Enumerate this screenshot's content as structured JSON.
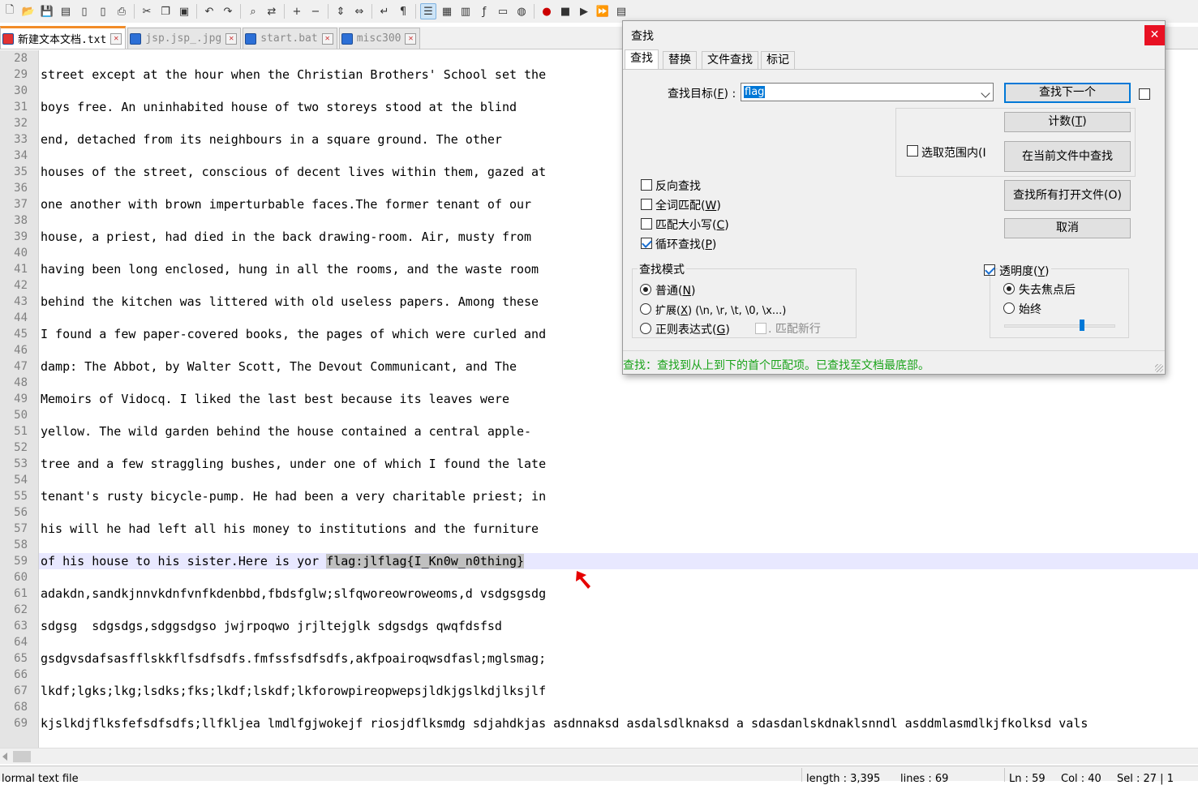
{
  "toolbar": {
    "icons": [
      "new-file-icon",
      "open-file-icon",
      "save-icon",
      "save-all-icon",
      "close-icon",
      "close-all-icon",
      "print-icon",
      "cut-icon",
      "copy-icon",
      "paste-icon",
      "undo-icon",
      "redo-icon",
      "find-icon",
      "replace-icon",
      "zoom-in-icon",
      "zoom-out-icon",
      "sync-vertical-icon",
      "sync-horizontal-icon",
      "word-wrap-icon",
      "show-all-chars-icon",
      "indent-guide-icon",
      "user-lang-icon",
      "doc-map-icon",
      "function-list-icon",
      "folder-workspace-icon",
      "monitor-icon",
      "record-macro-icon",
      "stop-macro-icon",
      "play-macro-icon",
      "run-macro-multiple-icon",
      "save-macro-icon"
    ]
  },
  "tabs": [
    {
      "label": "新建文本文档.txt",
      "active": true,
      "icon_color": "#e33333"
    },
    {
      "label": "jsp.jsp_.jpg",
      "active": false,
      "icon_color": "#2c6fd6"
    },
    {
      "label": "start.bat",
      "active": false,
      "icon_color": "#2c6fd6"
    },
    {
      "label": "misc300",
      "active": false,
      "icon_color": "#2c6fd6"
    }
  ],
  "editor": {
    "lines": [
      {
        "n": "28",
        "text": ""
      },
      {
        "n": "29",
        "text": "street except at the hour when the Christian Brothers' School set the"
      },
      {
        "n": "30",
        "text": ""
      },
      {
        "n": "31",
        "text": "boys free. An uninhabited house of two storeys stood at the blind"
      },
      {
        "n": "32",
        "text": ""
      },
      {
        "n": "33",
        "text": "end, detached from its neighbours in a square ground. The other"
      },
      {
        "n": "34",
        "text": ""
      },
      {
        "n": "35",
        "text": "houses of the street, conscious of decent lives within them, gazed at"
      },
      {
        "n": "36",
        "text": ""
      },
      {
        "n": "37",
        "text": "one another with brown imperturbable faces.The former tenant of our"
      },
      {
        "n": "38",
        "text": ""
      },
      {
        "n": "39",
        "text": "house, a priest, had died in the back drawing-room. Air, musty from"
      },
      {
        "n": "40",
        "text": ""
      },
      {
        "n": "41",
        "text": "having been long enclosed, hung in all the rooms, and the waste room"
      },
      {
        "n": "42",
        "text": ""
      },
      {
        "n": "43",
        "text": "behind the kitchen was littered with old useless papers. Among these"
      },
      {
        "n": "44",
        "text": ""
      },
      {
        "n": "45",
        "text": "I found a few paper-covered books, the pages of which were curled and"
      },
      {
        "n": "46",
        "text": ""
      },
      {
        "n": "47",
        "text": "damp: The Abbot, by Walter Scott, The Devout Communicant, and The"
      },
      {
        "n": "48",
        "text": ""
      },
      {
        "n": "49",
        "text": "Memoirs of Vidocq. I liked the last best because its leaves were"
      },
      {
        "n": "50",
        "text": ""
      },
      {
        "n": "51",
        "text": "yellow. The wild garden behind the house contained a central apple-"
      },
      {
        "n": "52",
        "text": ""
      },
      {
        "n": "53",
        "text": "tree and a few straggling bushes, under one of which I found the late"
      },
      {
        "n": "54",
        "text": ""
      },
      {
        "n": "55",
        "text": "tenant's rusty bicycle-pump. He had been a very charitable priest; in"
      },
      {
        "n": "56",
        "text": ""
      },
      {
        "n": "57",
        "text": "his will he had left all his money to institutions and the furniture"
      },
      {
        "n": "58",
        "text": ""
      },
      {
        "n": "59",
        "text": "of his house to his sister.Here is yor ",
        "highlight": "flag:jlflag{I_Kn0w_n0thing}"
      },
      {
        "n": "60",
        "text": ""
      },
      {
        "n": "61",
        "text": "adakdn,sandkjnnvkdnfvnfkdenbbd,fbdsfglw;slfqworeowroweoms,d vsdgsgsdg"
      },
      {
        "n": "62",
        "text": ""
      },
      {
        "n": "63",
        "text": "sdgsg  sdgsdgs,sdggsdgso jwjrpoqwo jrjltejglk sdgsdgs qwqfdsfsd"
      },
      {
        "n": "64",
        "text": ""
      },
      {
        "n": "65",
        "text": "gsdgvsdafsasfflskkflfsdfsdfs.fmfssfsdfsdfs,akfpoairoqwsdfasl;mglsmag;"
      },
      {
        "n": "66",
        "text": ""
      },
      {
        "n": "67",
        "text": "lkdf;lgks;lkg;lsdks;fks;lkdf;lskdf;lkforowpireopwepsjldkjgslkdjlksjlf"
      },
      {
        "n": "68",
        "text": ""
      },
      {
        "n": "69",
        "text": "kjslkdjflksfefsdfsdfs;llfkljea lmdlfgjwokejf riosjdflksmdg sdjahdkjas asdnnaksd asdalsdlknaksd a sdasdanlskdnaklsnndl asddmlasmdlkjfkolksd vals"
      }
    ]
  },
  "status": {
    "filetype": "lormal text file",
    "length": "length : 3,395",
    "lines": "lines : 69",
    "ln": "Ln : 59",
    "col": "Col : 40",
    "sel": "Sel : 27 | 1"
  },
  "dialog": {
    "title": "查找",
    "close": "✕",
    "tabs": [
      "查找",
      "替换",
      "文件查找",
      "标记"
    ],
    "find_label": "查找目标(F) :",
    "find_value": "flag",
    "buttons": {
      "find_next": "查找下一个",
      "count": "计数(T)",
      "find_in_current": "在当前文件中查找",
      "find_all_open": "查找所有打开文件(O)",
      "cancel": "取消"
    },
    "in_selection": "选取范围内(I",
    "options": [
      {
        "label": "反向查找",
        "checked": false
      },
      {
        "label": "全词匹配(W)",
        "checked": false
      },
      {
        "label": "匹配大小写(C)",
        "checked": false
      },
      {
        "label": "循环查找(P)",
        "checked": true
      }
    ],
    "search_mode": {
      "title": "查找模式",
      "normal": "普通(N)",
      "extended": "扩展(X) (\\n, \\r, \\t, \\0, \\x...)",
      "regex": "正则表达式(G)",
      "match_newline": ". 匹配新行",
      "selected": "normal"
    },
    "transparency": {
      "title": "透明度(Y)",
      "checked": true,
      "on_lose_focus": "失去焦点后",
      "always": "始终",
      "selected": "on_lose_focus",
      "level": 0.7
    },
    "status_text": "查找：查找到从上到下的首个匹配项。已查找至文档最底部。"
  },
  "colors": {
    "accent": "#0078d7",
    "status_green": "#1aa31a",
    "close_red": "#e81123",
    "annotation_red": "#e60000",
    "match_highlight": "#c0c0c0",
    "current_line": "#e8e8ff"
  }
}
